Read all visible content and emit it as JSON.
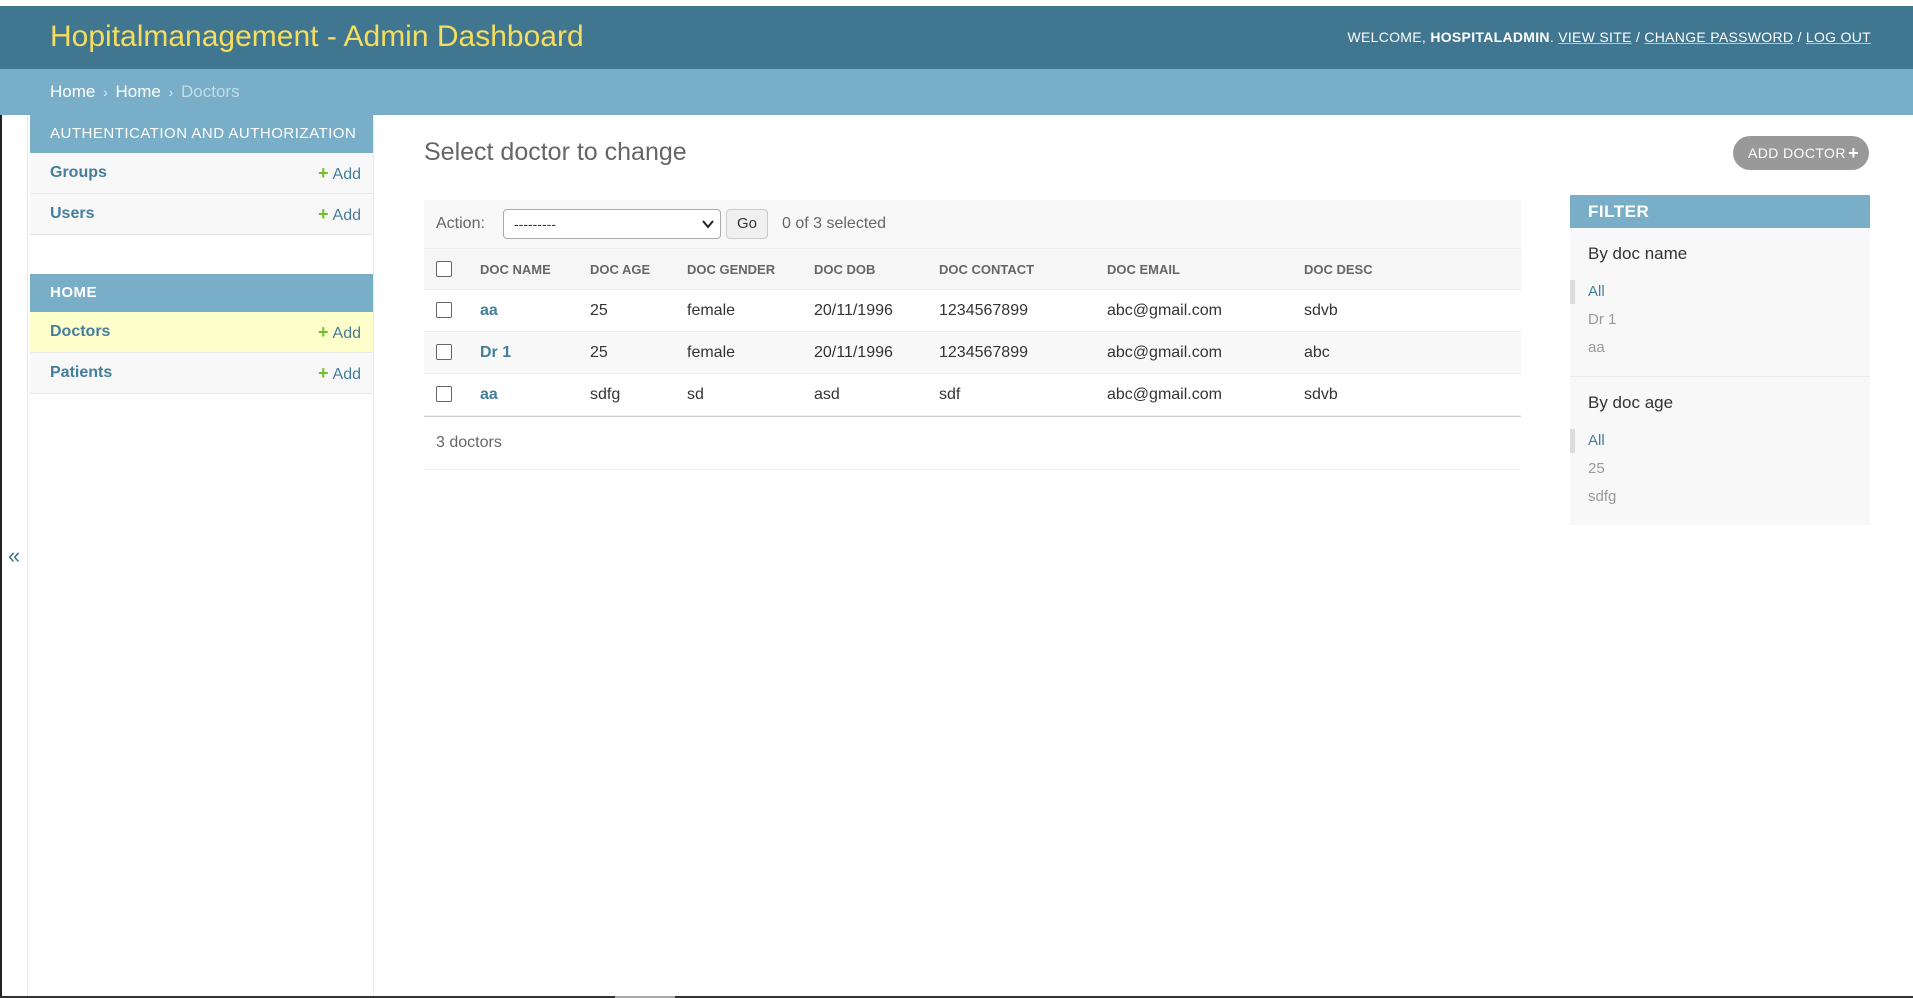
{
  "header": {
    "title": "Hopitalmanagement - Admin Dashboard",
    "welcome": "WELCOME,",
    "username": "HOSPITALADMIN",
    "view_site": "VIEW SITE",
    "change_password": "CHANGE PASSWORD",
    "log_out": "LOG OUT",
    "sep": "/"
  },
  "breadcrumbs": {
    "items": [
      "Home",
      "Home",
      "Doctors"
    ],
    "sep": "›"
  },
  "nav_toggle": "«",
  "sidebar": {
    "modules": [
      {
        "caption": "AUTHENTICATION AND AUTHORIZATION",
        "items": [
          {
            "name": "Groups",
            "add": "Add"
          },
          {
            "name": "Users",
            "add": "Add"
          }
        ]
      },
      {
        "caption": "HOME",
        "items": [
          {
            "name": "Doctors",
            "add": "Add"
          },
          {
            "name": "Patients",
            "add": "Add"
          }
        ]
      }
    ],
    "plus_glyph": "+"
  },
  "main": {
    "title": "Select doctor to change",
    "add_button": "ADD DOCTOR",
    "add_plus": "+",
    "actions": {
      "label": "Action:",
      "selected_value": "---------",
      "go": "Go",
      "counter": "0 of 3 selected"
    },
    "columns": [
      "DOC NAME",
      "DOC AGE",
      "DOC GENDER",
      "DOC DOB",
      "DOC CONTACT",
      "DOC EMAIL",
      "DOC DESC"
    ],
    "rows": [
      [
        "aa",
        "25",
        "female",
        "20/11/1996",
        "1234567899",
        "abc@gmail.com",
        "sdvb"
      ],
      [
        "Dr 1",
        "25",
        "female",
        "20/11/1996",
        "1234567899",
        "abc@gmail.com",
        "abc"
      ],
      [
        "aa",
        "sdfg",
        "sd",
        "asd",
        "sdf",
        "abc@gmail.com",
        "sdvb"
      ]
    ],
    "paginator": "3 doctors"
  },
  "filter": {
    "title": "FILTER",
    "groups": [
      {
        "title": "By doc name",
        "options": [
          "All",
          "Dr 1",
          "aa"
        ],
        "selected": 0
      },
      {
        "title": "By doc age",
        "options": [
          "All",
          "25",
          "sdfg"
        ],
        "selected": 0
      }
    ]
  },
  "colors": {
    "header_bg": "#417690",
    "brand": "#f5dd5d",
    "breadcrumb_bg": "#79aec8",
    "link": "#447e9b",
    "add_plus": "#70bf2b",
    "active_row": "#ffffcc"
  }
}
